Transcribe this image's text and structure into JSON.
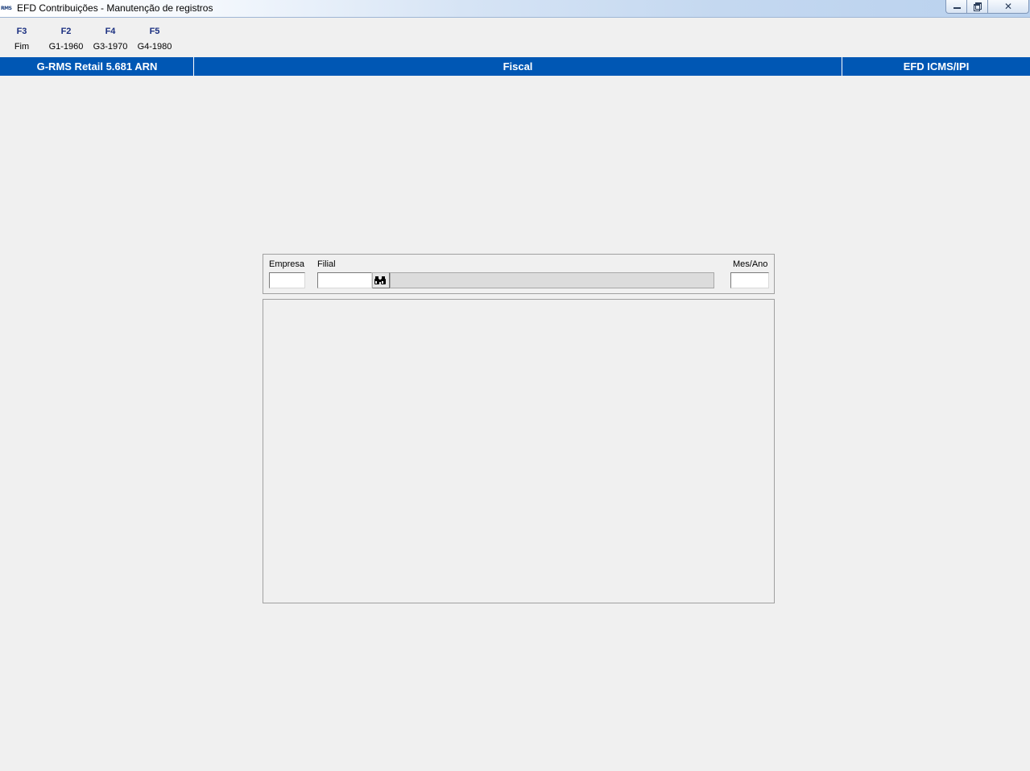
{
  "window": {
    "icon_text": "RMS",
    "title": "EFD Contribuições - Manutenção de registros",
    "close_glyph": "✕"
  },
  "function_keys": [
    {
      "key": "F3",
      "label": "Fim"
    },
    {
      "key": "F2",
      "label": "G1-1960"
    },
    {
      "key": "F4",
      "label": "G3-1970"
    },
    {
      "key": "F5",
      "label": "G4-1980"
    }
  ],
  "header": {
    "left": "G-RMS Retail 5.681 ARN",
    "center": "Fiscal",
    "right": "EFD ICMS/IPI"
  },
  "filters": {
    "empresa_label": "Empresa",
    "empresa_value": "",
    "filial_label": "Filial",
    "filial_value": "",
    "filial_description": "",
    "mes_ano_label": "Mes/Ano",
    "mes_ano_value": "",
    "search_icon": "binoculars-icon"
  },
  "colors": {
    "header_blue": "#0057b4",
    "background": "#f0f0f0"
  }
}
